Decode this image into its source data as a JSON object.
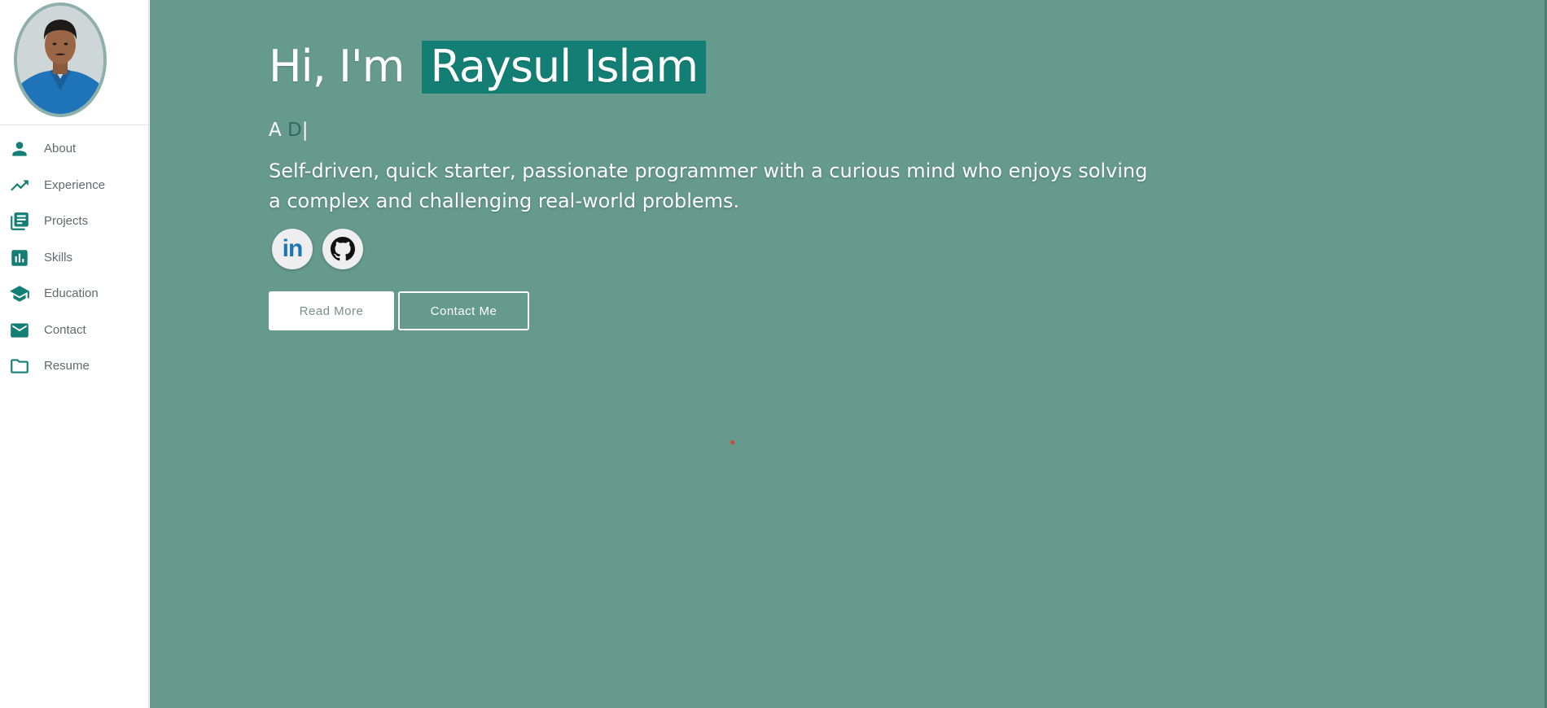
{
  "sidebar": {
    "items": [
      {
        "label": "About",
        "icon": "person-icon"
      },
      {
        "label": "Experience",
        "icon": "trending-up-icon"
      },
      {
        "label": "Projects",
        "icon": "library-books-icon"
      },
      {
        "label": "Skills",
        "icon": "bar-chart-icon"
      },
      {
        "label": "Education",
        "icon": "school-icon"
      },
      {
        "label": "Contact",
        "icon": "mail-icon"
      },
      {
        "label": "Resume",
        "icon": "folder-icon"
      }
    ]
  },
  "hero": {
    "greeting": "Hi, I'm",
    "name": "Raysul Islam",
    "typed_prefix": "A",
    "typed_letter": "D",
    "typed_cursor": "|",
    "bio": "Self-driven, quick starter, passionate programmer with a curious mind who enjoys solving a complex and challenging real-world problems.",
    "social": {
      "linkedin_text": "in",
      "linkedin_icon": "linkedin-icon",
      "github_icon": "github-icon"
    },
    "buttons": {
      "read_more": "Read More",
      "contact_me": "Contact Me"
    }
  },
  "colors": {
    "accent": "#137f74",
    "hero_background": "#659a8d",
    "nav_icon": "#137f74",
    "linkedin_blue": "#1c75b6"
  }
}
